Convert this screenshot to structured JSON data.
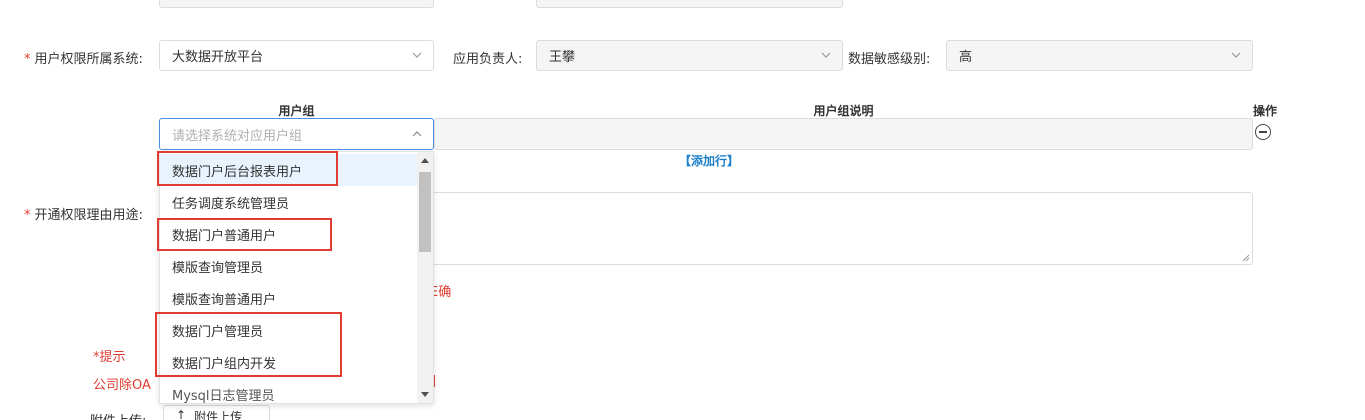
{
  "form": {
    "system_label": "用户权限所属系统:",
    "system_value": "大数据开放平台",
    "owner_label": "应用负责人:",
    "owner_value": "王攀",
    "sensitivity_label": "数据敏感级别:",
    "sensitivity_value": "高",
    "required_mark": "*",
    "reason_label": "开通权限理由用途:"
  },
  "table": {
    "col_group": "用户组",
    "col_desc": "用户组说明",
    "col_action": "操作",
    "group_placeholder": "请选择系统对应用户组",
    "add_row": "【添加行】"
  },
  "dropdown": {
    "items": [
      "数据门户后台报表用户",
      "任务调度系统管理员",
      "数据门户普通用户",
      "模版查询管理员",
      "模版查询普通用户",
      "数据门户管理员",
      "数据门户组内开发",
      "Mysql日志管理员"
    ],
    "highlighted_index": 0
  },
  "partial": {
    "validation_fragment": "E确",
    "hint_title": "*提示",
    "hint_line_left": "公司除OA",
    "hint_line_right": "]",
    "upload_label": "附件上传:",
    "upload_button": "附件上传"
  },
  "colors": {
    "required": "#e03c31",
    "link": "#1e7fc8",
    "focus_border": "#4a90e2",
    "highlight_bg": "#e8f3fe"
  }
}
